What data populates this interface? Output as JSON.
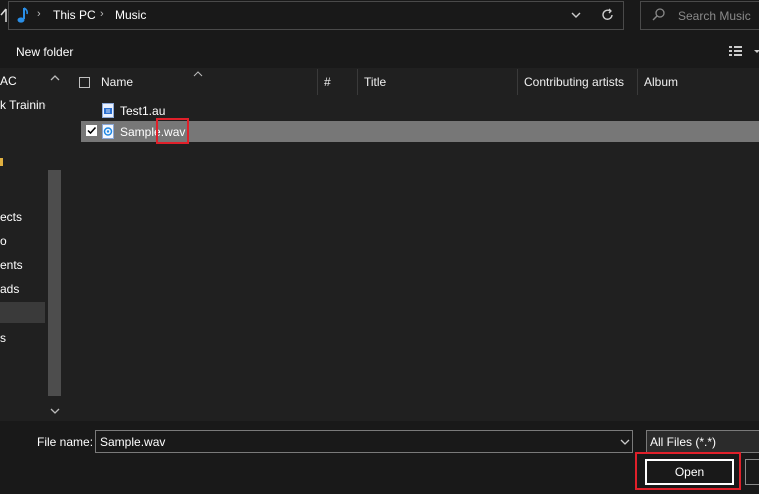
{
  "address": {
    "crumbs": [
      "This PC",
      "Music"
    ],
    "search_placeholder": "Search Music"
  },
  "toolbar": {
    "new_folder_label": "New folder"
  },
  "nav": {
    "items": [
      "AC",
      "k Training",
      "",
      "",
      "ects",
      "o",
      "ents",
      "ads",
      "",
      "s"
    ]
  },
  "columns": {
    "name": "Name",
    "number": "#",
    "title": "Title",
    "contributing_artists": "Contributing artists",
    "album": "Album"
  },
  "files": [
    {
      "name": "Test1.au",
      "selected": false
    },
    {
      "name": "Sample.wav",
      "selected": true
    }
  ],
  "bottom": {
    "file_name_label": "File name:",
    "file_name_value": "Sample.wav",
    "filter_value": "All Files (*.*)",
    "open_label": "Open"
  },
  "colors": {
    "highlight_red": "#e0202a",
    "selected_row": "#777777",
    "music_accent": "#2a8fe8"
  }
}
